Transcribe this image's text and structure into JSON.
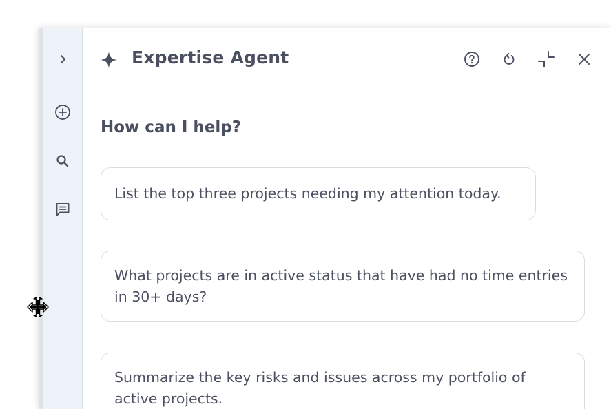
{
  "header": {
    "title": "Expertise Agent",
    "icons": [
      "sparkle-icon",
      "help-icon",
      "refresh-icon",
      "collapse-icon",
      "close-icon"
    ]
  },
  "rail": {
    "items": [
      "chevron-right-icon",
      "add-circle-icon",
      "search-icon",
      "chat-icon"
    ]
  },
  "main": {
    "greeting": "How can I help?",
    "suggestions": [
      "List the top three projects needing my attention today.",
      "What projects are in active status that have had no time entries in 30+ days?",
      "Summarize the key risks and issues across my portfolio of active projects."
    ]
  },
  "colors": {
    "text": "#4a5060",
    "rail_bg": "#eef3f9",
    "border": "#d9dde3"
  }
}
